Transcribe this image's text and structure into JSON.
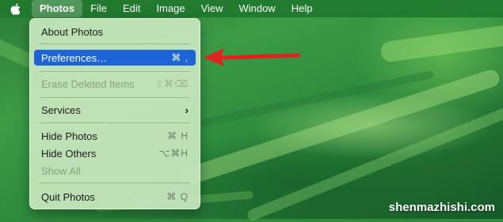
{
  "menubar": {
    "apple_icon": "apple-logo-icon",
    "items": [
      "Photos",
      "File",
      "Edit",
      "Image",
      "View",
      "Window",
      "Help"
    ]
  },
  "menu": {
    "about": "About Photos",
    "preferences": "Preferences…",
    "preferences_shortcut": "⌘ ,",
    "erase": "Erase Deleted Items",
    "erase_shortcut": "⇧⌘⌫",
    "services": "Services",
    "services_chevron": "›",
    "hide": "Hide Photos",
    "hide_shortcut": "⌘ H",
    "hide_others": "Hide Others",
    "hide_others_shortcut": "⌥⌘H",
    "show_all": "Show All",
    "quit": "Quit Photos",
    "quit_shortcut": "⌘ Q"
  },
  "annotation": {
    "arrow_color": "#e0231f"
  },
  "watermark": "shenmazhishi.com"
}
